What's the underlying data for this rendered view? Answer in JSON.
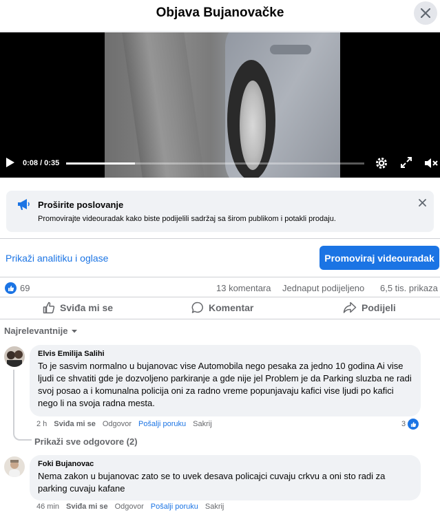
{
  "header": {
    "title": "Objava Bujanovačke"
  },
  "video": {
    "time": "0:08 / 0:35",
    "progress": 0.23
  },
  "promo": {
    "title": "Proširite poslovanje",
    "description": "Promovirajte videouradak kako biste podijelili sadržaj sa širom publikom i potakli prodaju."
  },
  "analytics": {
    "link": "Prikaži analitiku i oglase",
    "boost": "Promoviraj videouradak"
  },
  "stats": {
    "likes": "69",
    "comments": "13 komentara",
    "shares": "Jednaput podijeljeno",
    "views": "6,5 tis. prikaza"
  },
  "actions": {
    "like": "Sviđa mi se",
    "comment": "Komentar",
    "share": "Podijeli"
  },
  "sort": {
    "label": "Najrelevantnije"
  },
  "comments": [
    {
      "author": "Elvis Emilija Salihi",
      "text": "To je sasvim normalno u bujanovac vise Automobila nego pesaka za jedno 10 godina Ai vise ljudi ce shvatiti gde je dozvoljeno parkiranje a gde nije jel Problem je da Parking sluzba ne radi svoj posao a i komunalna policija oni za radno vreme popunjavaju kafici vise ljudi po kafici nego li na svoja radna mesta.",
      "time": "2 h",
      "like": "Sviđa mi se",
      "reply": "Odgovor",
      "message": "Pošalji poruku",
      "hide": "Sakrij",
      "reactions": "3",
      "replies_link": "Prikaži sve odgovore (2)"
    },
    {
      "author": "Foki Bujanovac",
      "text": "Nema zakon u bujanovac zato se to uvek desava policajci cuvaju crkvu a oni sto radi za parking cuvaju kafane",
      "time": "46 min",
      "like": "Sviđa mi se",
      "reply": "Odgovor",
      "message": "Pošalji poruku",
      "hide": "Sakrij"
    }
  ],
  "colors": {
    "accent": "#1b74e4",
    "bubble": "#f0f2f5",
    "muted": "#65676b"
  }
}
